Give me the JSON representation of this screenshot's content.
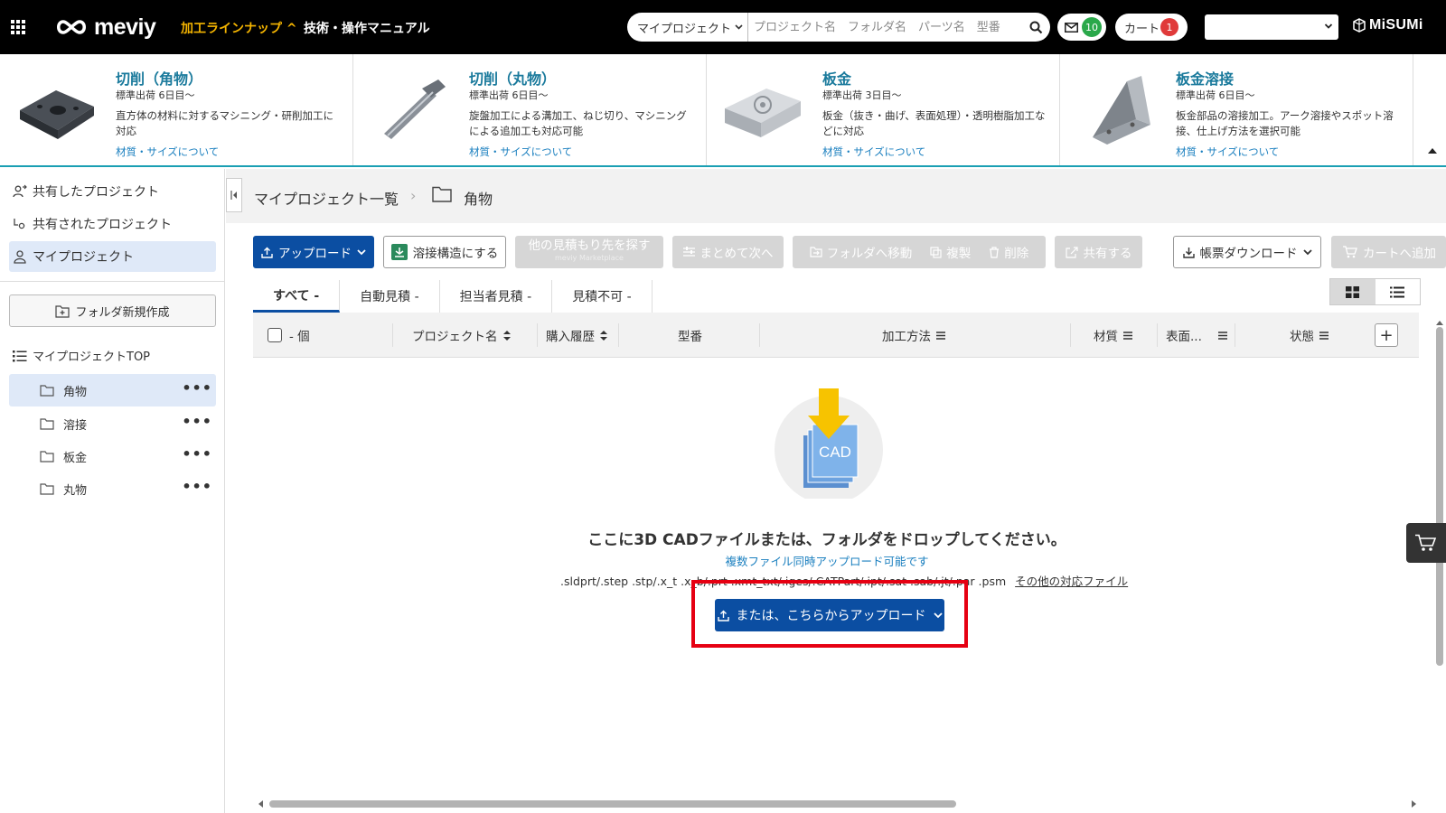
{
  "header": {
    "logo_text": "meviy",
    "nav_lineup": "加工ラインナップ ^",
    "nav_manual": "技術・操作マニュアル",
    "search_scope": "マイプロジェクト",
    "search_placeholder": "プロジェクト名　フォルダ名　パーツ名　型番",
    "mail_count": "10",
    "cart_label": "カート",
    "cart_count": "1",
    "account_value": "",
    "brand": "MiSUMi"
  },
  "categories": [
    {
      "title": "切削（角物）",
      "ship": "標準出荷 6日目～",
      "desc": "直方体の材料に対するマシニング・研削加工に対応",
      "link": "材質・サイズについて"
    },
    {
      "title": "切削（丸物）",
      "ship": "標準出荷 6日目～",
      "desc": "旋盤加工による溝加工、ねじ切り、マシニングによる追加工も対応可能",
      "link": "材質・サイズについて"
    },
    {
      "title": "板金",
      "ship": "標準出荷 3日目～",
      "desc": "板金（抜き・曲げ、表面処理）・透明樹脂加工などに対応",
      "link": "材質・サイズについて"
    },
    {
      "title": "板金溶接",
      "ship": "標準出荷 6日目～",
      "desc": "板金部品の溶接加工。アーク溶接やスポット溶接、仕上げ方法を選択可能",
      "link": "材質・サイズについて"
    }
  ],
  "sidebar": {
    "nav": [
      "共有したプロジェクト",
      "共有されたプロジェクト",
      "マイプロジェクト"
    ],
    "new_folder": "フォルダ新規作成",
    "tree_top": "マイプロジェクトTOP",
    "folders": [
      "角物",
      "溶接",
      "板金",
      "丸物"
    ]
  },
  "breadcrumb": {
    "root": "マイプロジェクト一覧",
    "current": "角物"
  },
  "toolbar": {
    "upload": "アップロード",
    "weld": "溶接構造にする",
    "other_quote": "他の見積もり先を探す",
    "other_quote_sub": "meviy Marketplace",
    "batch_next": "まとめて次へ",
    "move_folder": "フォルダへ移動",
    "duplicate": "複製",
    "delete": "削除",
    "share": "共有する",
    "report_dl": "帳票ダウンロード",
    "add_cart": "カートへ追加"
  },
  "tabs": [
    "すべて -",
    "自動見積 -",
    "担当者見積 -",
    "見積不可 -"
  ],
  "table_headers": {
    "count": "- 個",
    "project_name": "プロジェクト名",
    "purchase_history": "購入履歴",
    "model_no": "型番",
    "process": "加工方法",
    "material": "材質",
    "surface": "表面...",
    "status": "状態"
  },
  "drop": {
    "icon_label": "CAD",
    "title": "ここに3D CADファイルまたは、フォルダをドロップしてください。",
    "note": "複数ファイル同時アップロード可能です",
    "formats": ".sldprt/.step .stp/.x_t .x_b/.prt .xmt_txt/.iges/.CATPart/.ipt/.sat .sab/.jt/.par .psm",
    "formats_link": "その他の対応ファイル",
    "upload_btn": "または、こちらからアップロード"
  },
  "colors": {
    "accent_blue": "#0b4ea2",
    "nav_yellow": "#f4b400",
    "highlight_red": "#e60012"
  }
}
